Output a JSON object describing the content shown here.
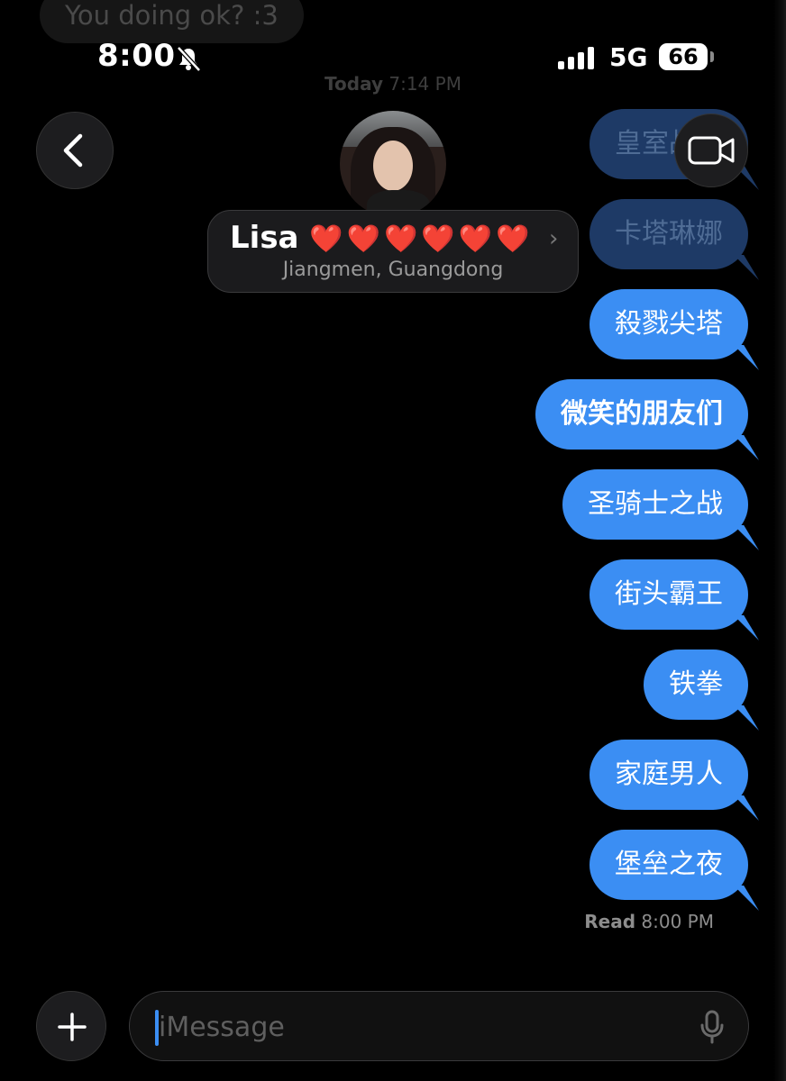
{
  "previous_message": "You doing ok? :3",
  "status_bar": {
    "time": "8:00",
    "network": "5G",
    "battery": "66"
  },
  "timestamp": {
    "day": "Today",
    "time": "7:14 PM"
  },
  "contact": {
    "name": "Lisa",
    "hearts": "❤️❤️❤️❤️❤️❤️",
    "chevron": "›",
    "location": "Jiangmen, Guangdong"
  },
  "messages": [
    {
      "text": "皇室战争"
    },
    {
      "text": "卡塔琳娜"
    },
    {
      "text": "殺戮尖塔"
    },
    {
      "text": "微笑的朋友们"
    },
    {
      "text": "圣骑士之战"
    },
    {
      "text": "街头霸王"
    },
    {
      "text": "铁拳"
    },
    {
      "text": "家庭男人"
    },
    {
      "text": "堡垒之夜"
    }
  ],
  "read_receipt": {
    "label": "Read",
    "time": "8:00 PM"
  },
  "compose": {
    "placeholder": "iMessage"
  },
  "colors": {
    "bubble": "#3b8ef3",
    "background": "#000000"
  }
}
